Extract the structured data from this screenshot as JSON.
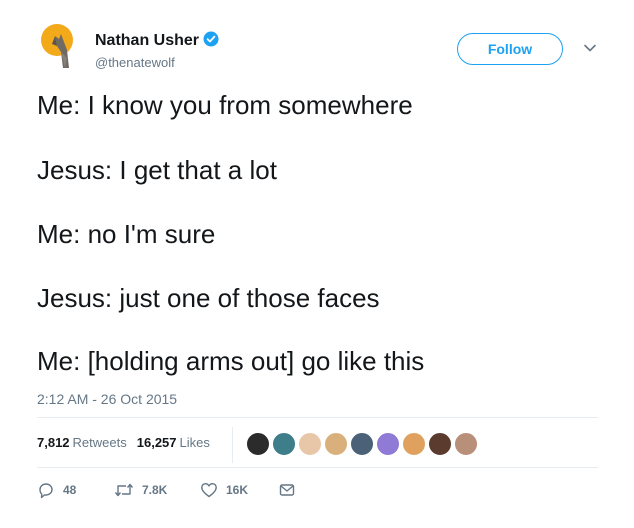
{
  "author": {
    "display_name": "Nathan Usher",
    "handle": "@thenatewolf",
    "verified": true,
    "avatar_icon": "howling-wolf-moon-avatar"
  },
  "follow_label": "Follow",
  "tweet_lines": [
    "Me: I know you from somewhere",
    "Jesus: I get that a lot",
    "Me: no I'm sure",
    "Jesus: just one of those faces",
    "Me: [holding arms out] go like this"
  ],
  "timestamp": "2:12 AM - 26 Oct 2015",
  "stats": {
    "retweets_count": "7,812",
    "retweets_label": "Retweets",
    "likes_count": "16,257",
    "likes_label": "Likes"
  },
  "actions": {
    "replies": "48",
    "retweets": "7.8K",
    "likes": "16K"
  },
  "colors": {
    "accent": "#1da1f2",
    "secondary_text": "#657786",
    "divider": "#e6ecf0"
  }
}
